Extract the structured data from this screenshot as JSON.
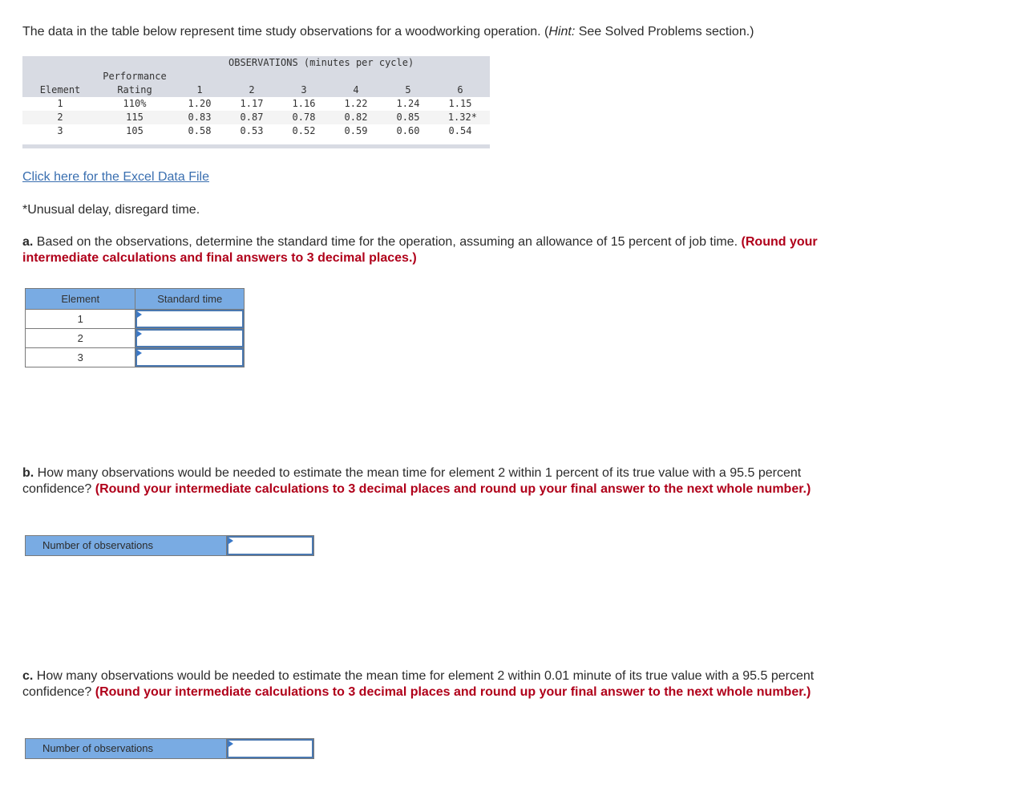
{
  "intro": {
    "text_before_hint": "The data in the table below represent time study observations for a woodworking operation. (",
    "hint_label": "Hint:",
    "text_after_hint": " See Solved Problems section.)"
  },
  "obs_table": {
    "group_header": "OBSERVATIONS (minutes per cycle)",
    "col_element": "Element",
    "col_perf_line1": "Performance",
    "col_perf_line2": "Rating",
    "obs_cols": [
      "1",
      "2",
      "3",
      "4",
      "5",
      "6"
    ],
    "rows": [
      {
        "element": "1",
        "rating": "110%",
        "obs": [
          "1.20",
          "1.17",
          "1.16",
          "1.22",
          "1.24",
          "1.15"
        ]
      },
      {
        "element": "2",
        "rating": "115",
        "obs": [
          "0.83",
          "0.87",
          "0.78",
          "0.82",
          "0.85",
          "1.32*"
        ]
      },
      {
        "element": "3",
        "rating": "105",
        "obs": [
          "0.58",
          "0.53",
          "0.52",
          "0.59",
          "0.60",
          "0.54"
        ]
      }
    ]
  },
  "excel_link": "Click here for the Excel Data File",
  "footnote": "*Unusual delay, disregard time.",
  "part_a": {
    "label": "a.",
    "text": " Based on the observations, determine the standard time for the operation, assuming an allowance of 15 percent of job time. ",
    "instruction": "(Round your intermediate calculations and final answers to 3 decimal places.)",
    "table": {
      "col_element": "Element",
      "col_standard_time": "Standard time",
      "rows": [
        {
          "element": "1",
          "value": ""
        },
        {
          "element": "2",
          "value": ""
        },
        {
          "element": "3",
          "value": ""
        }
      ]
    }
  },
  "part_b": {
    "label": "b.",
    "text": " How many observations would be needed to estimate the mean time for element 2 within 1 percent of its true value with a 95.5 percent confidence? ",
    "instruction": "(Round your intermediate calculations to 3 decimal places and round up your final answer to the next whole number.)",
    "answer_label": "Number of observations",
    "answer_value": ""
  },
  "part_c": {
    "label": "c.",
    "text": " How many observations would be needed to estimate the mean time for element 2 within 0.01 minute of its true value with a 95.5 percent confidence? ",
    "instruction": "(Round your intermediate calculations to 3 decimal places and round up your final answer to the next whole number.)",
    "answer_label": "Number of observations",
    "answer_value": ""
  }
}
